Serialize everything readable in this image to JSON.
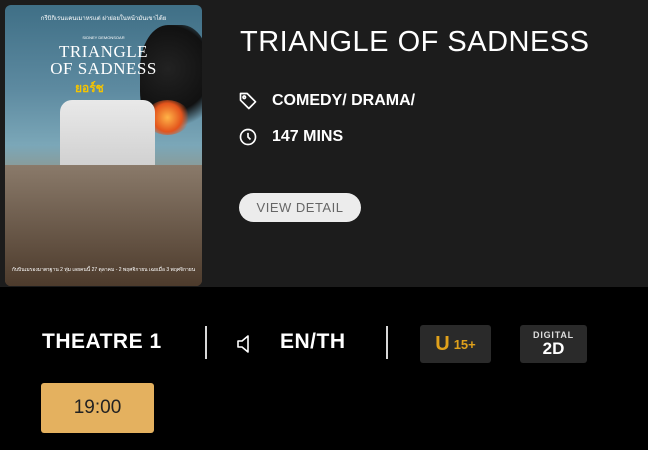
{
  "movie": {
    "title": "TRIANGLE OF SADNESS",
    "genre": "COMEDY/ DRAMA/",
    "runtime": "147 MINS",
    "detail_button_label": "VIEW DETAIL",
    "poster": {
      "tagline": "กรีบิกิเรนแคนเมาหรแต่ ผ่าย่อยในหน้ามันเขาได้ย",
      "credit": "SIDNEY DEMONSOAR",
      "title_line1": "TRIANGLE",
      "title_line2": "OF SADNESS",
      "thai_title": "ยอร์ช",
      "bottom_text": "กับบินเมรองมาตรฐาน 2 ทุ่ม เลยคนนี้ 27 ตุลาคม - 2 พฤศจิกายน เฉยเมื่อ 3 พฤศจิกายน"
    }
  },
  "showtime": {
    "theatre": "THEATRE 1",
    "language": "EN/TH",
    "rating_letter": "U",
    "rating_age": "15+",
    "format_top": "DIGITAL",
    "format_bottom": "2D",
    "time": "19:00"
  },
  "icons": {
    "genre": "tag-icon",
    "runtime": "clock-icon",
    "audio": "speaker-icon"
  },
  "colors": {
    "background": "#000000",
    "card": "#1c1c1c",
    "time_button": "#e4b15f",
    "rating": "#e0a11b"
  }
}
